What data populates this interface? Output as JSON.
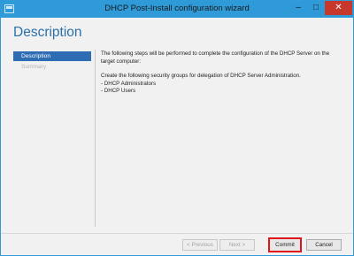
{
  "window": {
    "title": "DHCP Post-Install configuration wizard",
    "minimize_glyph": "–",
    "maximize_glyph": "□",
    "close_glyph": "✕"
  },
  "page": {
    "title": "Description"
  },
  "nav": {
    "items": [
      {
        "label": "Description",
        "state": "active"
      },
      {
        "label": "Summary",
        "state": "disabled"
      }
    ]
  },
  "content": {
    "intro": "The following steps will be performed to complete the configuration of the DHCP Server on the target computer:",
    "groups_intro": "Create the following security groups for delegation of DHCP Server Administration.",
    "groups": [
      "- DHCP Administrators",
      "- DHCP Users"
    ]
  },
  "footer": {
    "previous_label": "< Previous",
    "next_label": "Next >",
    "commit_label": "Commit",
    "cancel_label": "Cancel"
  },
  "colors": {
    "titlebar": "#2e9ad8",
    "accent": "#2e6db4",
    "title_text": "#2a6fa8",
    "highlight": "#e0151b",
    "close": "#c7372c"
  },
  "icons": {
    "app": "server-icon"
  }
}
